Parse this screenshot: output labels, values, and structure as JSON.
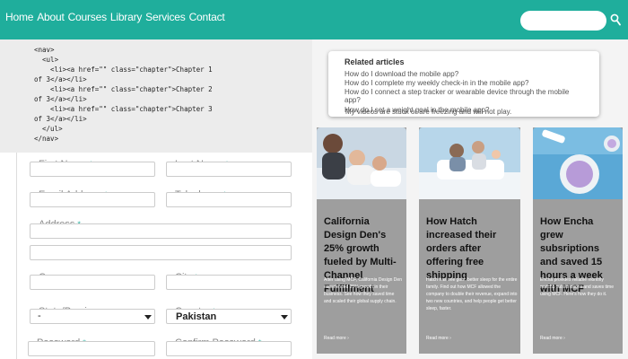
{
  "nav": {
    "items": [
      "Home",
      "About",
      "Courses",
      "Library",
      "Services",
      "Contact"
    ]
  },
  "search": {
    "placeholder": ""
  },
  "code_snippet": "<nav>\n  <ul>\n    <li><a href=\"\" class=\"chapter\">Chapter 1\nof 3</a></li>\n    <li><a href=\"\" class=\"chapter\">Chapter 2\nof 3</a></li>\n    <li><a href=\"\" class=\"chapter\">Chapter 3\nof 3</a></li>\n  </ul>\n</nav>",
  "form": {
    "first_name": "First Name",
    "last_name": "Last Name",
    "email": "Email Address",
    "telephone": "Telephone",
    "address": "Address",
    "company": "Company",
    "city": "City",
    "state": "State/Province",
    "state_value": "-",
    "country": "Country",
    "country_value": "Pakistan",
    "password": "Password",
    "confirm_password": "Confirm Password",
    "required_mark": "*"
  },
  "related": {
    "title": "Related articles",
    "links": [
      "How do I download the mobile app?",
      "How do I complete my weekly check-in in the mobile app?",
      "How do I connect a step tracker or wearable device through the mobile app?",
      "How do I set a weight goal in the mobile app?",
      "My videos are stuck or are freezing and will not play."
    ]
  },
  "cards": [
    {
      "title": "California Design Den's 25% growth fueled by Multi-Channel Fulfillment",
      "text": "After using MCF, California Design Den experienced 25% growth in their business. See how they saved time and scaled their global supply chain.",
      "read_more": "Read more ›"
    },
    {
      "title": "How Hatch increased their orders after offering free shipping",
      "text": "Hatch has one goal: better sleep for the entire family. Find out how MCF allowed the company to double their revenue, expand into two new countries, and help people get better sleep, faster.",
      "read_more": "Read more ›"
    },
    {
      "title": "How Encha grew subsriptions and saved 15 hours a week with MCF",
      "text": "Encha provides reliable monthly matcha subscriptions and saves time using MCF. Here's how they do it.",
      "read_more": "Read more ›"
    }
  ],
  "colors": {
    "header": "#1fae9c",
    "card_bg": "#9e9e9e"
  }
}
